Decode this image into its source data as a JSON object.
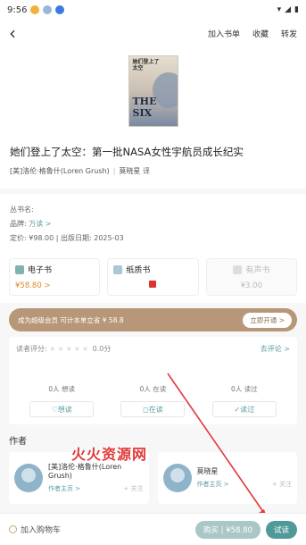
{
  "status": {
    "time": "9:56"
  },
  "nav": {
    "actions": [
      "加入书单",
      "收藏",
      "转发"
    ]
  },
  "cover": {
    "title_line1": "她们登上了",
    "title_line2": "太空",
    "big_text": "THE SIX"
  },
  "book": {
    "title": "她们登上了太空：第一批NASA女性宇航员成长纪实",
    "authors": [
      "[美]洛伦·格鲁什(Loren Grush)",
      "莫晓星"
    ],
    "role_suffix": "译"
  },
  "info": {
    "series_label": "丛书名:",
    "brand_label": "品牌:",
    "brand_value": "万读 >",
    "price_line": "定价: ¥98.00  |  出版日期: 2025-03"
  },
  "formats": [
    {
      "name": "电子书",
      "price": "¥58.80 >",
      "disabled": false
    },
    {
      "name": "纸质书",
      "price": "",
      "disabled": false
    },
    {
      "name": "有声书",
      "price": "¥3.00",
      "disabled": true
    }
  ],
  "vip": {
    "text": "成为超级会员  可计本单立省 ¥ 58.8",
    "button": "立即开通 >"
  },
  "rating": {
    "label": "读者评分:",
    "stars": "★★★★★",
    "score": "0.0分",
    "link": "去评论 >",
    "stats": [
      "0人 想读",
      "0人 在读",
      "0人 读过"
    ],
    "actions": [
      "想读",
      "在读",
      "读过"
    ]
  },
  "author_section": {
    "title": "作者",
    "cards": [
      {
        "name": "[美]洛伦·格鲁什(Loren Grush)",
        "home": "作者主页 >",
        "follow": "+ 关注"
      },
      {
        "name": "莫晓星",
        "home": "作者主页 >",
        "follow": "+ 关注"
      }
    ]
  },
  "watermark": "火火资源网",
  "bottom": {
    "cart": "加入购物车",
    "buy": "购买 | ¥58.80",
    "trial": "试读"
  },
  "colors": {
    "accent": "#4f9a99",
    "vip": "#b79777",
    "price": "#e28a2c",
    "annotation": "#e23a3a"
  }
}
